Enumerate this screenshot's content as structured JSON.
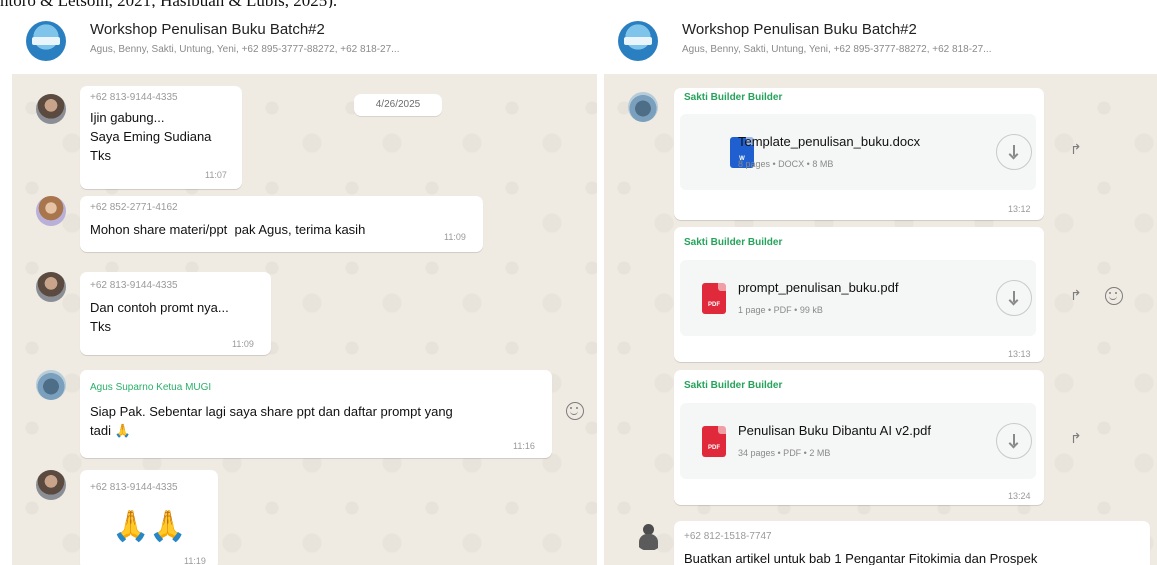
{
  "caption": "ntoro & Letsoin, 2021; Hasibuan & Lubis, 2025).",
  "left_panel": {
    "header": {
      "title": "Workshop Penulisan Buku Batch#2",
      "subtitle": "Agus, Benny, Sakti, Untung, Yeni, +62 895-3777-88272, +62 818-27..."
    },
    "date_chip": "4/26/2025",
    "messages": [
      {
        "sender": "+62 813-9144-4335",
        "lines": [
          "Ijin gabung...",
          "Saya Eming Sudiana",
          "Tks"
        ],
        "time": "11:07"
      },
      {
        "sender": "+62 852-2771-4162",
        "lines": [
          "Mohon share materi/ppt  pak Agus, terima kasih"
        ],
        "time": "11:09"
      },
      {
        "sender": "+62 813-9144-4335",
        "lines": [
          "Dan contoh promt nya...",
          "Tks"
        ],
        "time": "11:09"
      },
      {
        "sender": "Agus Suparno Ketua MUGI",
        "lines": [
          "Siap Pak. Sebentar lagi saya share ppt dan daftar prompt yang",
          "tadi"
        ],
        "emoji": "🙏",
        "time": "11:16"
      },
      {
        "sender": "+62 813-9144-4335",
        "emoji": "🙏🙏",
        "time": "11:19"
      }
    ]
  },
  "right_panel": {
    "header": {
      "title": "Workshop Penulisan Buku Batch#2",
      "subtitle": "Agus, Benny, Sakti, Untung, Yeni, +62 895-3777-88272, +62 818-27..."
    },
    "files": [
      {
        "sender": "Sakti Builder Builder",
        "name": "Template_penulisan_buku.docx",
        "meta": "8 pages • DOCX • 8 MB",
        "icon_tag": "W",
        "time": "13:12"
      },
      {
        "sender": "Sakti Builder Builder",
        "name": "prompt_penulisan_buku.pdf",
        "meta": "1 page • PDF • 99 kB",
        "icon_tag": "PDF",
        "time": "13:13"
      },
      {
        "sender": "Sakti Builder Builder",
        "name": "Penulisan Buku Dibantu AI v2.pdf",
        "meta": "34 pages • PDF • 2 MB",
        "icon_tag": "PDF",
        "time": "13:24"
      }
    ],
    "last_message": {
      "sender": "+62 812-1518-7747",
      "text": "Buatkan artikel untuk bab 1 Pengantar Fitokimia dan Prospek"
    }
  }
}
